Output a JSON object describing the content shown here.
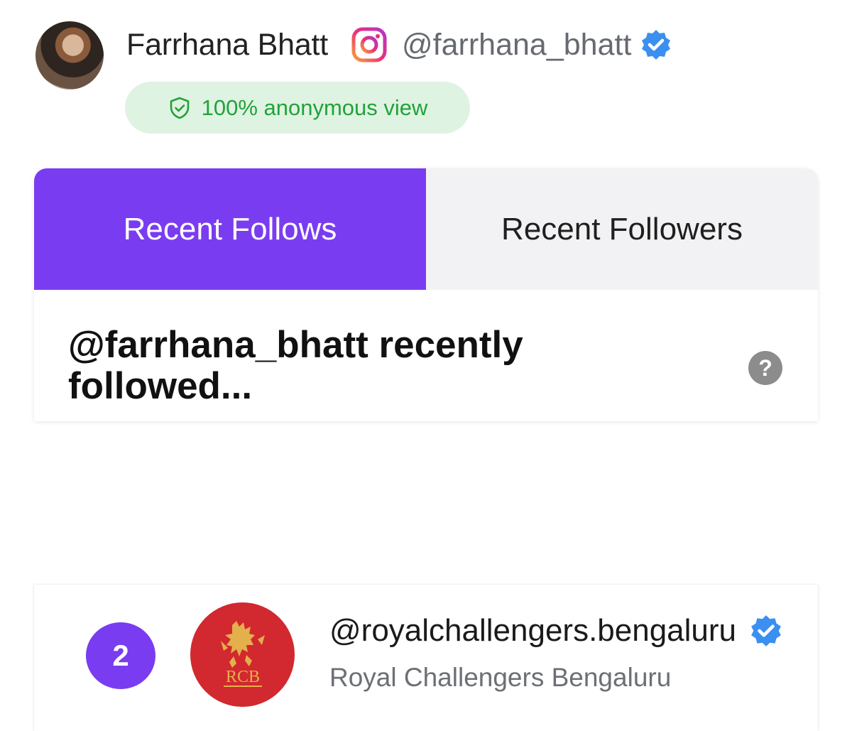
{
  "profile": {
    "name": "Farrhana Bhatt",
    "handle": "@farrhana_bhatt",
    "anon_label": "100% anonymous view"
  },
  "tabs": [
    {
      "label": "Recent Follows",
      "active": true
    },
    {
      "label": "Recent Followers",
      "active": false
    }
  ],
  "section": {
    "heading": "@farrhana_bhatt recently followed...",
    "help_symbol": "?"
  },
  "list": [
    {
      "rank": "2",
      "handle": "@royalchallengers.bengaluru",
      "name": "Royal Challengers Bengaluru",
      "logo_text": "RCB",
      "verified": true
    }
  ],
  "icons": {
    "platform": "instagram-icon",
    "verified": "verified-badge-icon",
    "shield": "shield-check-icon",
    "help": "help-icon"
  },
  "colors": {
    "accent": "#7a3cf0",
    "verified": "#3b8ff0",
    "anon_text": "#22a23a",
    "anon_bg": "#dff3e2",
    "team_logo_bg": "#d2282f",
    "team_logo_gold": "#e3b04b"
  }
}
